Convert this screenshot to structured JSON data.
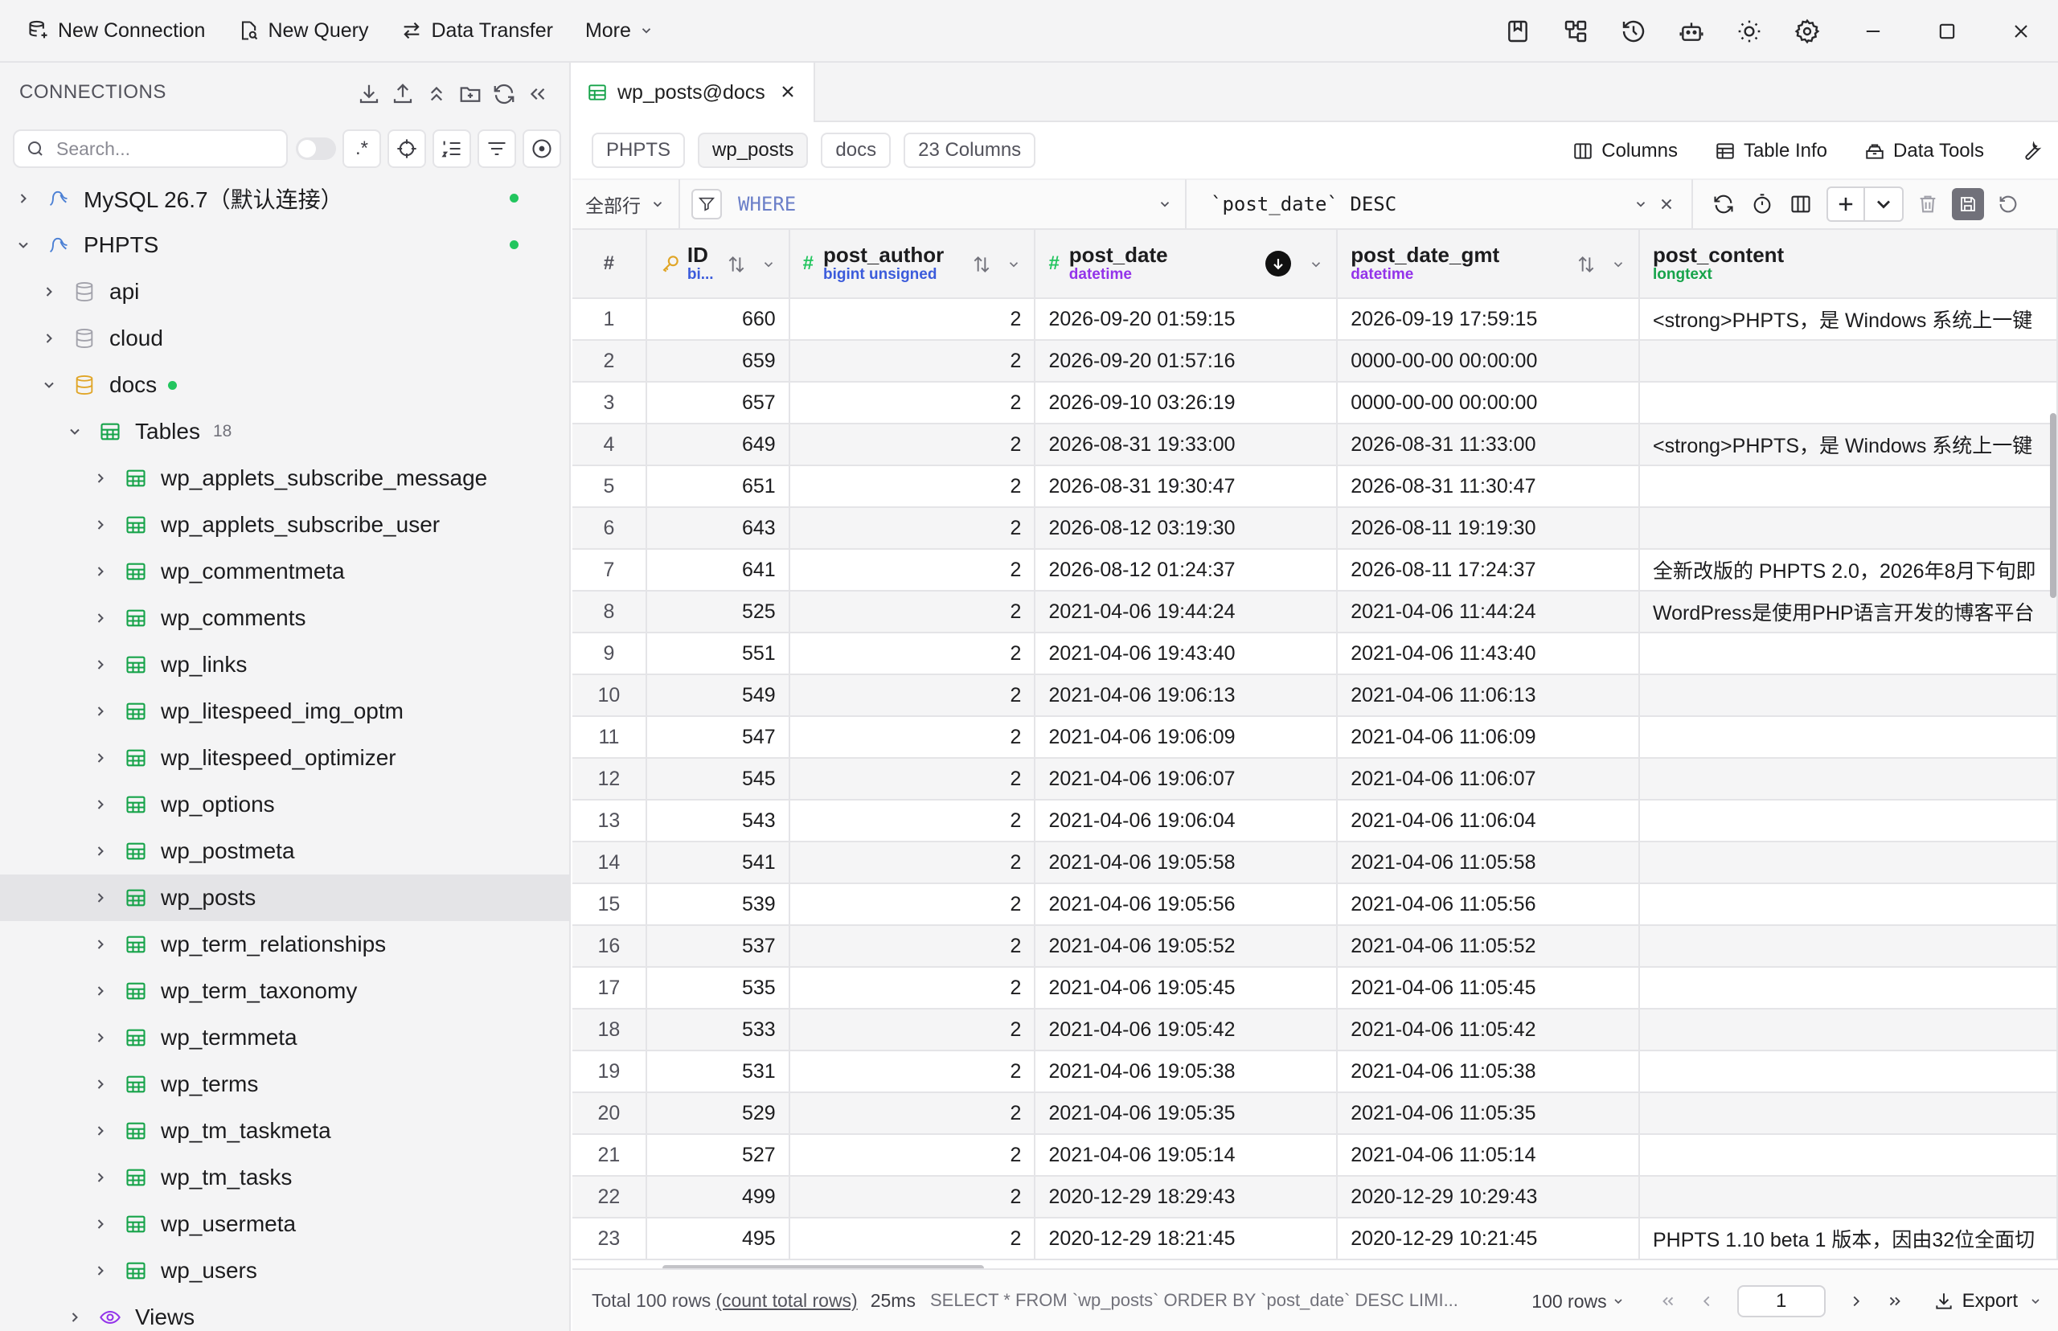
{
  "toolbar": {
    "new_connection": "New Connection",
    "new_query": "New Query",
    "data_transfer": "Data Transfer",
    "more": "More"
  },
  "sidebar": {
    "title": "CONNECTIONS",
    "search_placeholder": "Search...",
    "regex_label": ".*",
    "tree": [
      {
        "label": "MySQL 26.7（默认连接）",
        "level": 0,
        "icon": "mysql-icon",
        "expanded": false,
        "status": "connected"
      },
      {
        "label": "PHPTS",
        "level": 0,
        "icon": "mysql-icon",
        "expanded": true,
        "status": "connected"
      },
      {
        "label": "api",
        "level": 1,
        "icon": "database-icon",
        "expanded": false
      },
      {
        "label": "cloud",
        "level": 1,
        "icon": "database-icon",
        "expanded": false
      },
      {
        "label": "docs",
        "level": 1,
        "icon": "database-icon",
        "expanded": true,
        "status": "connected"
      },
      {
        "label": "Tables",
        "level": 2,
        "icon": "tables-icon",
        "expanded": true,
        "count": "18"
      },
      {
        "label": "wp_applets_subscribe_message",
        "level": 3,
        "icon": "table-icon"
      },
      {
        "label": "wp_applets_subscribe_user",
        "level": 3,
        "icon": "table-icon"
      },
      {
        "label": "wp_commentmeta",
        "level": 3,
        "icon": "table-icon"
      },
      {
        "label": "wp_comments",
        "level": 3,
        "icon": "table-icon"
      },
      {
        "label": "wp_links",
        "level": 3,
        "icon": "table-icon"
      },
      {
        "label": "wp_litespeed_img_optm",
        "level": 3,
        "icon": "table-icon"
      },
      {
        "label": "wp_litespeed_optimizer",
        "level": 3,
        "icon": "table-icon"
      },
      {
        "label": "wp_options",
        "level": 3,
        "icon": "table-icon"
      },
      {
        "label": "wp_postmeta",
        "level": 3,
        "icon": "table-icon"
      },
      {
        "label": "wp_posts",
        "level": 3,
        "icon": "table-icon",
        "selected": true
      },
      {
        "label": "wp_term_relationships",
        "level": 3,
        "icon": "table-icon"
      },
      {
        "label": "wp_term_taxonomy",
        "level": 3,
        "icon": "table-icon"
      },
      {
        "label": "wp_termmeta",
        "level": 3,
        "icon": "table-icon"
      },
      {
        "label": "wp_terms",
        "level": 3,
        "icon": "table-icon"
      },
      {
        "label": "wp_tm_taskmeta",
        "level": 3,
        "icon": "table-icon"
      },
      {
        "label": "wp_tm_tasks",
        "level": 3,
        "icon": "table-icon"
      },
      {
        "label": "wp_usermeta",
        "level": 3,
        "icon": "table-icon"
      },
      {
        "label": "wp_users",
        "level": 3,
        "icon": "table-icon"
      },
      {
        "label": "Views",
        "level": 2,
        "icon": "views-icon",
        "expanded": false
      }
    ]
  },
  "tab": {
    "label": "wp_posts@docs"
  },
  "breadcrumbs": {
    "connection": "PHPTS",
    "table": "wp_posts",
    "database": "docs",
    "columns_count": "23 Columns"
  },
  "actions": {
    "columns": "Columns",
    "table_info": "Table Info",
    "data_tools": "Data Tools"
  },
  "filter": {
    "row_select": "全部行",
    "where_placeholder": "WHERE",
    "order_by": "`post_date` DESC"
  },
  "grid": {
    "columns": [
      {
        "name": "#"
      },
      {
        "name": "ID",
        "type": "bi..."
      },
      {
        "name": "post_author",
        "type": "bigint unsigned"
      },
      {
        "name": "post_date",
        "type": "datetime",
        "sort": "desc"
      },
      {
        "name": "post_date_gmt",
        "type": "datetime"
      },
      {
        "name": "post_content",
        "type": "longtext"
      }
    ],
    "rows": [
      [
        "1",
        "660",
        "2",
        "2026-09-20 01:59:15",
        "2026-09-19 17:59:15",
        "<strong>PHPTS，是 Windows 系统上一键"
      ],
      [
        "2",
        "659",
        "2",
        "2026-09-20 01:57:16",
        "0000-00-00 00:00:00",
        ""
      ],
      [
        "3",
        "657",
        "2",
        "2026-09-10 03:26:19",
        "0000-00-00 00:00:00",
        ""
      ],
      [
        "4",
        "649",
        "2",
        "2026-08-31 19:33:00",
        "2026-08-31 11:33:00",
        "<strong>PHPTS，是 Windows 系统上一键"
      ],
      [
        "5",
        "651",
        "2",
        "2026-08-31 19:30:47",
        "2026-08-31 11:30:47",
        ""
      ],
      [
        "6",
        "643",
        "2",
        "2026-08-12 03:19:30",
        "2026-08-11 19:19:30",
        ""
      ],
      [
        "7",
        "641",
        "2",
        "2026-08-12 01:24:37",
        "2026-08-11 17:24:37",
        "全新改版的 PHPTS 2.0，2026年8月下旬即"
      ],
      [
        "8",
        "525",
        "2",
        "2021-04-06 19:44:24",
        "2021-04-06 11:44:24",
        "WordPress是使用PHP语言开发的博客平台"
      ],
      [
        "9",
        "551",
        "2",
        "2021-04-06 19:43:40",
        "2021-04-06 11:43:40",
        ""
      ],
      [
        "10",
        "549",
        "2",
        "2021-04-06 19:06:13",
        "2021-04-06 11:06:13",
        ""
      ],
      [
        "11",
        "547",
        "2",
        "2021-04-06 19:06:09",
        "2021-04-06 11:06:09",
        ""
      ],
      [
        "12",
        "545",
        "2",
        "2021-04-06 19:06:07",
        "2021-04-06 11:06:07",
        ""
      ],
      [
        "13",
        "543",
        "2",
        "2021-04-06 19:06:04",
        "2021-04-06 11:06:04",
        ""
      ],
      [
        "14",
        "541",
        "2",
        "2021-04-06 19:05:58",
        "2021-04-06 11:05:58",
        ""
      ],
      [
        "15",
        "539",
        "2",
        "2021-04-06 19:05:56",
        "2021-04-06 11:05:56",
        ""
      ],
      [
        "16",
        "537",
        "2",
        "2021-04-06 19:05:52",
        "2021-04-06 11:05:52",
        ""
      ],
      [
        "17",
        "535",
        "2",
        "2021-04-06 19:05:45",
        "2021-04-06 11:05:45",
        ""
      ],
      [
        "18",
        "533",
        "2",
        "2021-04-06 19:05:42",
        "2021-04-06 11:05:42",
        ""
      ],
      [
        "19",
        "531",
        "2",
        "2021-04-06 19:05:38",
        "2021-04-06 11:05:38",
        ""
      ],
      [
        "20",
        "529",
        "2",
        "2021-04-06 19:05:35",
        "2021-04-06 11:05:35",
        ""
      ],
      [
        "21",
        "527",
        "2",
        "2021-04-06 19:05:14",
        "2021-04-06 11:05:14",
        ""
      ],
      [
        "22",
        "499",
        "2",
        "2020-12-29 18:29:43",
        "2020-12-29 10:29:43",
        ""
      ],
      [
        "23",
        "495",
        "2",
        "2020-12-29 18:21:45",
        "2020-12-29 10:21:45",
        "PHPTS 1.10 beta 1 版本，因由32位全面切"
      ]
    ]
  },
  "status": {
    "total": "Total 100 rows",
    "count_link": "(count total rows)",
    "time": "25ms",
    "sql": "SELECT * FROM `wp_posts` ORDER BY `post_date` DESC LIMI...",
    "rows_per_page": "100 rows",
    "page": "1",
    "export": "Export"
  },
  "colors": {
    "accent_green": "#22c55e",
    "type_blue": "#3b5bdb",
    "mysql_blue": "#4a7fd4",
    "db_yellow": "#e0a526",
    "views_purple": "#9333ea"
  }
}
